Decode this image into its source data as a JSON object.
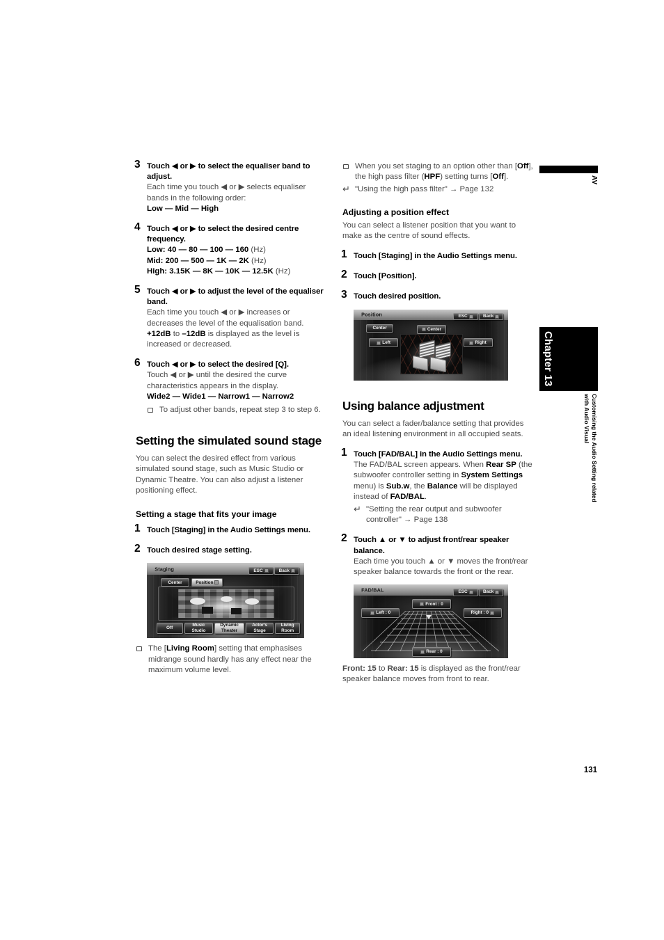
{
  "page": {
    "number": "131"
  },
  "sidebar": {
    "av_label": "AV",
    "chapter_label": "Chapter 13",
    "chapter_subtitle_line1": "Customising the Audio Setting related",
    "chapter_subtitle_line2": "with Audio Visual"
  },
  "left_column": {
    "step3": {
      "num": "3",
      "title": "Touch ◀ or ▶ to select the equaliser band to adjust.",
      "body": "Each time you touch ◀ or ▶ selects equaliser bands in the following order:",
      "order": "Low — Mid — High"
    },
    "step4": {
      "num": "4",
      "title": "Touch ◀ or ▶ to select the desired centre frequency.",
      "low": "Low: 40 — 80 — 100 — 160",
      "low_unit": "(Hz)",
      "mid": "Mid: 200 — 500 — 1K — 2K",
      "mid_unit": "(Hz)",
      "high": "High: 3.15K — 8K — 10K — 12.5K",
      "high_unit": "(Hz)"
    },
    "step5": {
      "num": "5",
      "title": "Touch ◀ or ▶ to adjust the level of the equaliser band.",
      "body1": "Each time you touch ◀ or ▶ increases or decreases the level of the equalisation band.",
      "range_from": "+12dB",
      "range_mid": "to",
      "range_to": "–12dB",
      "body2": "is displayed as the level is increased or decreased."
    },
    "step6": {
      "num": "6",
      "title": "Touch ◀ or ▶ to select the desired [Q].",
      "body": "Touch ◀ or ▶ until the desired the curve characteristics appears in the display.",
      "order": "Wide2 — Wide1 — Narrow1 — Narrow2",
      "note": "To adjust other bands, repeat step 3 to step 6."
    },
    "heading_sound_stage": "Setting the simulated sound stage",
    "sound_stage_body": "You can select the desired effect from various simulated sound stage, such as Music Studio or Dynamic Theatre. You can also adjust a listener positioning effect.",
    "heading_stage_fits": "Setting a stage that fits your image",
    "stage_step1": {
      "num": "1",
      "title": "Touch [Staging] in the Audio Settings menu."
    },
    "stage_step2": {
      "num": "2",
      "title": "Touch desired stage setting."
    },
    "stage_note_pre": "The [",
    "stage_note_bold": "Living Room",
    "stage_note_post": "] setting that emphasises midrange sound hardly has any effect near the maximum volume level."
  },
  "right_column": {
    "note_hpf_a": "When you set staging to an option other than [",
    "note_hpf_off1": "Off",
    "note_hpf_b": "], the high pass filter (",
    "note_hpf_hpf": "HPF",
    "note_hpf_c": ") setting turns [",
    "note_hpf_off2": "Off",
    "note_hpf_d": "].",
    "ref_hpf": "\"Using the high pass filter\" → Page 132",
    "heading_position_effect": "Adjusting a position effect",
    "position_effect_body": "You can select a listener position that you want to make as the centre of sound effects.",
    "pos_step1": {
      "num": "1",
      "title": "Touch [Staging] in the Audio Settings menu."
    },
    "pos_step2": {
      "num": "2",
      "title": "Touch [Position]."
    },
    "pos_step3": {
      "num": "3",
      "title": "Touch desired position."
    },
    "heading_balance": "Using balance adjustment",
    "balance_body": "You can select a fader/balance setting that provides an ideal listening environment in all occupied seats.",
    "bal_step1": {
      "num": "1",
      "title": "Touch [FAD/BAL] in the Audio Settings menu.",
      "b1": "The FAD/BAL screen appears. When ",
      "rear_sp": "Rear SP",
      "b2": " (the subwoofer controller setting in ",
      "system_settings": "System Settings",
      "b3": " menu) is ",
      "subw": "Sub.w",
      "b4": ", the ",
      "balance": "Balance",
      "b5": " will be displayed instead of ",
      "fadbal": "FAD/BAL",
      "b6": ".",
      "ref": "\"Setting the rear output and subwoofer controller\" → Page 138"
    },
    "bal_step2": {
      "num": "2",
      "title": "Touch ▲ or ▼ to adjust front/rear speaker balance.",
      "body": "Each time you touch ▲ or ▼ moves the front/rear speaker balance towards the front or the rear."
    },
    "bal_caption_front": "Front: 15",
    "bal_caption_to": "to",
    "bal_caption_rear": "Rear: 15",
    "bal_caption_rest": "is displayed as the front/rear speaker balance moves from front to rear."
  },
  "screens": {
    "staging": {
      "title": "Staging",
      "esc": "ESC",
      "back": "Back",
      "center": "Center",
      "position": "Position",
      "presets": [
        "Off",
        "Music Studio",
        "Dynamic Theater",
        "Actor's Stage",
        "Living Room"
      ]
    },
    "position": {
      "title": "Position",
      "esc": "ESC",
      "back": "Back",
      "tab_center": "Center",
      "btn_center": "Center",
      "btn_left": "Left",
      "btn_right": "Right"
    },
    "fadbal": {
      "title": "FAD/BAL",
      "esc": "ESC",
      "back": "Back",
      "front": "Front : 0",
      "rear": "Rear : 0",
      "left": "Left : 0",
      "right": "Right : 0"
    }
  }
}
